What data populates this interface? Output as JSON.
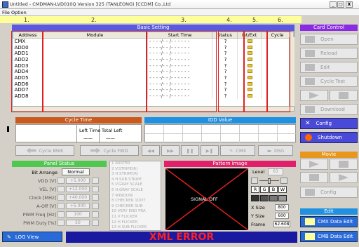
{
  "window": {
    "title": "Untitled - CMDMAN-LVD010Q Version 325 (TANLEONG) [CCDM] Co.,Ltd",
    "min": "_",
    "max": "□",
    "close": "X"
  },
  "menu": {
    "file": "File",
    "option": "Option"
  },
  "markers": [
    "1.",
    "2.",
    "3.",
    "4.",
    "5.",
    "6."
  ],
  "basic": {
    "title": "Basic Setting",
    "cols": [
      "Address",
      "Module",
      "Start Time",
      "Status",
      "Int/Ext",
      "Cycle"
    ],
    "rows": [
      {
        "a": "CMX",
        "t": "- - - -/- - /- - - - - -",
        "s": "?"
      },
      {
        "a": "ADD0",
        "t": "- - - -/- - /- - - - - -",
        "s": "?"
      },
      {
        "a": "ADD1",
        "t": "- - - -/- - /- - - - - -",
        "s": "?"
      },
      {
        "a": "ADD2",
        "t": "- - - -/- - /- - - - - -",
        "s": "?"
      },
      {
        "a": "ADD3",
        "t": "- - - -/- - /- - - - - -",
        "s": "?"
      },
      {
        "a": "ADD4",
        "t": "- - - -/- - /- - - - - -",
        "s": "?"
      },
      {
        "a": "ADD5",
        "t": "- - - -/- - /- - - - - -",
        "s": "?"
      },
      {
        "a": "ADD6",
        "t": "- - - -/- - /- - - - - -",
        "s": "?"
      },
      {
        "a": "ADD7",
        "t": "- - - -/- - /- - - - - -",
        "s": "?"
      },
      {
        "a": "ADD8",
        "t": "- - - -/- - /- - - - - -",
        "s": "?"
      }
    ]
  },
  "card_control": {
    "title": "Card Control",
    "buttons": [
      "Open",
      "Reload",
      "Edit",
      "Cycle Test",
      "Download",
      "Config",
      "Shutdown"
    ]
  },
  "cycle_time": {
    "title": "Cycle Time",
    "left": "Left Time",
    "total": "Total Left",
    "left_val": "——",
    "total_val": "——"
  },
  "idd": {
    "title": "IDD Value"
  },
  "cycle_btns": {
    "bwk": "Cycle BWK",
    "fwd": "Cycle FWD",
    "cmx": "CMX",
    "dsg": "DSG"
  },
  "panel": {
    "title": "Panel Status",
    "bit_label": "Bit Arrange",
    "bit_value": "Normal",
    "rows": [
      {
        "l": "VDD [V]",
        "v": "+5.000"
      },
      {
        "l": "VEL [V]",
        "v": "+12.000"
      },
      {
        "l": "Clock [MHz]",
        "v": "+40.000"
      },
      {
        "l": "A-Off [V]",
        "v": "+5.000"
      },
      {
        "l": "PWM Freq [Hz]",
        "v": "100"
      },
      {
        "l": "PWM Duty [%]",
        "v": "50"
      }
    ]
  },
  "patterns": [
    "RASTER",
    "V.STRIPE(R)",
    "H.STRIPE(R)",
    "H.SUB.STRIPE",
    "V.GRAY SCALE",
    "H.GRAY SCALE",
    "WINDOW",
    "CHECKER 1DOT",
    "CHECKER SUB",
    "VERY END FRA",
    "V FLICKER",
    "H FLICKER",
    "H SUB FLICKER"
  ],
  "pattern_image": {
    "title": "Pattern Image",
    "signal": "SIGNAL OFF",
    "level_label": "Level",
    "level": "63",
    "rgb": [
      "R",
      "G",
      "B",
      "W"
    ],
    "xsize_label": "X Size",
    "xsize": "800",
    "ysize_label": "Y Size",
    "ysize": "600",
    "frame_label": "Frame",
    "frame": "62.608"
  },
  "movie": {
    "title": "Movie",
    "config": "Config"
  },
  "edit": {
    "title": "Edit",
    "cmx": "CMX Data Edit",
    "cmb": "CMB Data Edit"
  },
  "log": {
    "label": "LOG View"
  },
  "status": {
    "error": "XML ERROR"
  }
}
